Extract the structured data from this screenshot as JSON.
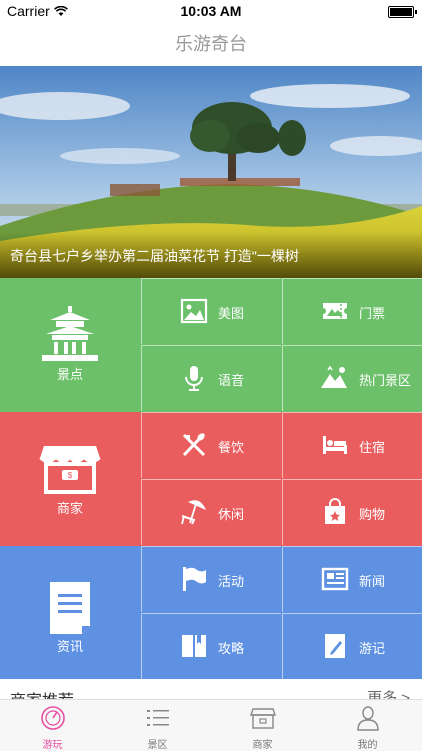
{
  "status": {
    "carrier": "Carrier",
    "time": "10:03 AM"
  },
  "nav": {
    "title": "乐游奇台"
  },
  "hero": {
    "caption": "奇台县七户乡举办第二届油菜花节 打造\"一棵树"
  },
  "sections": [
    {
      "color": "#6cc06a",
      "main": {
        "label": "景点",
        "icon": "pavilion-icon"
      },
      "items": [
        {
          "label": "美图",
          "icon": "photo-icon"
        },
        {
          "label": "门票",
          "icon": "ticket-icon"
        },
        {
          "label": "语音",
          "icon": "microphone-icon"
        },
        {
          "label": "热门景区",
          "icon": "landscape-icon"
        }
      ]
    },
    {
      "color": "#ea5d5f",
      "main": {
        "label": "商家",
        "icon": "shop-icon"
      },
      "items": [
        {
          "label": "餐饮",
          "icon": "utensils-icon"
        },
        {
          "label": "住宿",
          "icon": "bed-icon"
        },
        {
          "label": "休闲",
          "icon": "umbrella-chair-icon"
        },
        {
          "label": "购物",
          "icon": "shopping-bag-icon"
        }
      ]
    },
    {
      "color": "#5f91e2",
      "main": {
        "label": "资讯",
        "icon": "document-icon"
      },
      "items": [
        {
          "label": "活动",
          "icon": "flag-icon"
        },
        {
          "label": "新闻",
          "icon": "newspaper-icon"
        },
        {
          "label": "攻略",
          "icon": "guide-book-icon"
        },
        {
          "label": "游记",
          "icon": "journal-pen-icon"
        }
      ]
    }
  ],
  "recommend": {
    "title": "商家推荐",
    "more": "更多 >"
  },
  "tabs": [
    {
      "label": "游玩",
      "icon": "compass-icon",
      "active": true
    },
    {
      "label": "景区",
      "icon": "list-icon"
    },
    {
      "label": "商家",
      "icon": "store-icon"
    },
    {
      "label": "我的",
      "icon": "user-icon"
    }
  ],
  "colors": {
    "accent": "#e74ea2",
    "green": "#6cc06a",
    "red": "#ea5d5f",
    "blue": "#5f91e2"
  }
}
